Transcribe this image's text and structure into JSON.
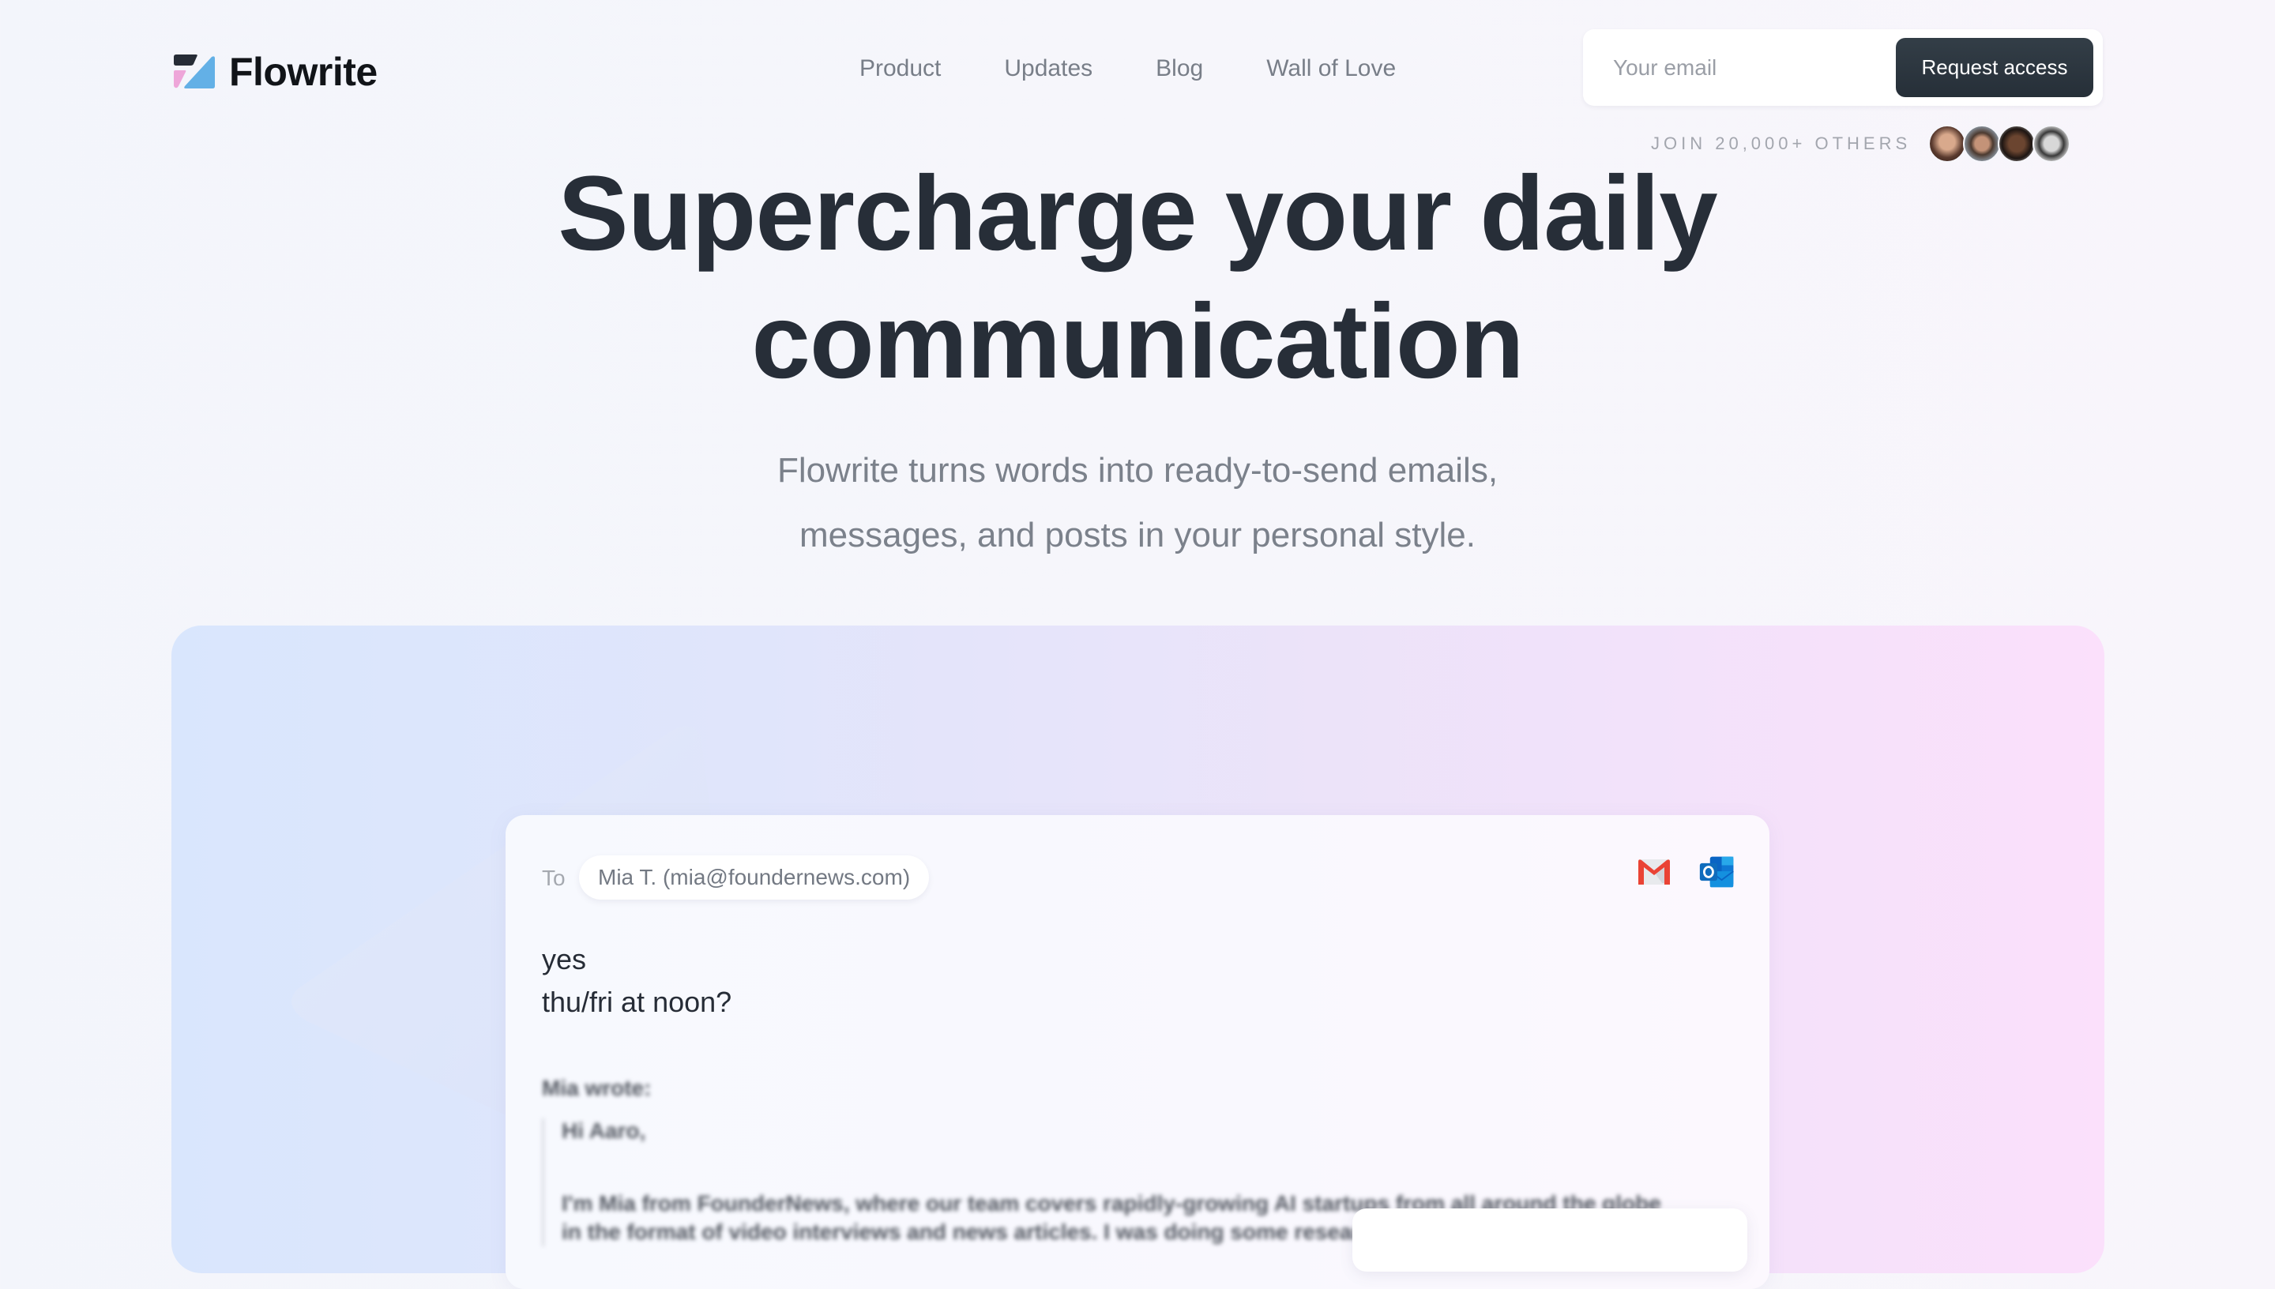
{
  "brand": {
    "name": "Flowrite",
    "colors": {
      "dark": "#262c36",
      "blue": "#63b0e6",
      "pink": "#eea6d9"
    }
  },
  "nav": {
    "items": [
      {
        "label": "Product"
      },
      {
        "label": "Updates"
      },
      {
        "label": "Blog"
      },
      {
        "label": "Wall of Love"
      }
    ]
  },
  "signup": {
    "email_placeholder": "Your email",
    "email_value": "",
    "button_label": "Request access",
    "social_proof": "JOIN 20,000+ OTHERS",
    "avatars": [
      {
        "name": "avatar-woman-1",
        "color": "#6b4a3c"
      },
      {
        "name": "avatar-man-beard",
        "color": "#7a8592"
      },
      {
        "name": "avatar-woman-2",
        "color": "#4a3328"
      },
      {
        "name": "avatar-man-bw",
        "color": "#c9c9c9"
      }
    ]
  },
  "hero": {
    "headline_line1": "Supercharge your daily",
    "headline_line2": "communication",
    "subtitle_line1": "Flowrite turns words into ready-to-send emails,",
    "subtitle_line2": "messages, and posts in your personal style."
  },
  "demo": {
    "to_label": "To",
    "recipient": "Mia T. (mia@foundernews.com)",
    "integrations": [
      "gmail-icon",
      "outlook-icon"
    ],
    "draft_lines": [
      "yes",
      "thu/fri at noon?"
    ],
    "quoted": {
      "header": "Mia wrote:",
      "greeting": "Hi Aaro,",
      "body_line1": "I'm Mia from FounderNews, where our team covers rapidly-growing AI startups from all around the globe",
      "body_line2": "in the format of video interviews and news articles. I was doing some research"
    }
  }
}
